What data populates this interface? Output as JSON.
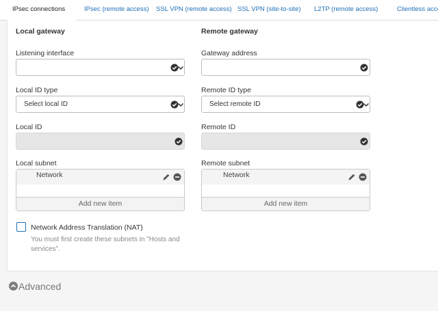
{
  "tabs": [
    {
      "label": "IPsec connections",
      "active": true
    },
    {
      "label": "IPsec (remote access)"
    },
    {
      "label": "SSL VPN (remote access)"
    },
    {
      "label": "SSL VPN (site-to-site)"
    },
    {
      "label": "L2TP (remote access)"
    },
    {
      "label": "Clientless acce"
    }
  ],
  "local": {
    "heading": "Local gateway",
    "listening_label": "Listening interface",
    "listening_value": "",
    "id_type_label": "Local ID type",
    "id_type_value": "Select local ID",
    "id_label": "Local ID",
    "subnet_label": "Local subnet",
    "subnet_item": "Network",
    "add_label": "Add new item"
  },
  "remote": {
    "heading": "Remote gateway",
    "address_label": "Gateway address",
    "id_type_label": "Remote ID type",
    "id_type_value": "Select remote ID",
    "id_label": "Remote ID",
    "subnet_label": "Remote subnet",
    "subnet_item": "Network",
    "add_label": "Add new item"
  },
  "nat": {
    "label": "Network Address Translation (NAT)",
    "help": "You must first create these subnets in \"Hosts and services\"."
  },
  "advanced_label": "Advanced",
  "colors": {
    "accent": "#1f6fb5",
    "icon": "#333333",
    "muted": "#888888"
  }
}
